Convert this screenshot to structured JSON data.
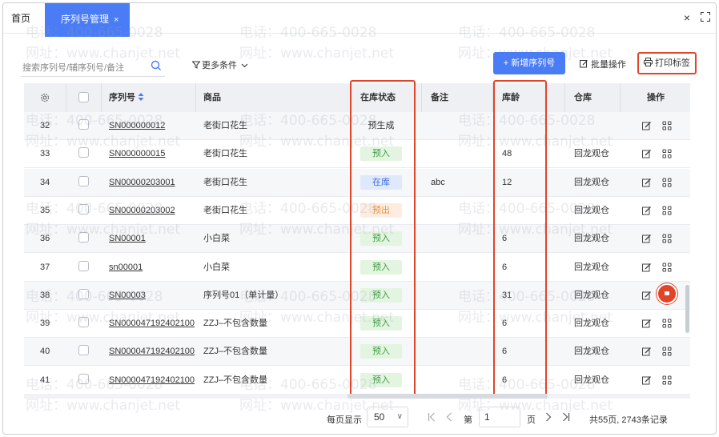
{
  "tabs": {
    "home": "首页",
    "active": "序列号管理",
    "close": "×"
  },
  "window": {
    "close": "×"
  },
  "toolbar": {
    "search_placeholder": "搜索序列号/辅序列号/备注",
    "more_filter": "更多条件",
    "new_button": "+ 新增序列号",
    "batch_button": "批量操作",
    "print_button": "打印标签"
  },
  "table": {
    "headers": {
      "serial": "序列号",
      "product": "商品",
      "status": "在库状态",
      "note": "备注",
      "age": "库龄",
      "warehouse": "仓库",
      "ops": "操作"
    },
    "rows": [
      {
        "no": "32",
        "serial": "SN000000012",
        "product": "老街口花生",
        "status": "预生成",
        "status_type": "pre",
        "note": "",
        "age": "",
        "warehouse": ""
      },
      {
        "no": "33",
        "serial": "SN000000015",
        "product": "老街口花生",
        "status": "预入",
        "status_type": "in",
        "note": "",
        "age": "48",
        "warehouse": "回龙观仓"
      },
      {
        "no": "34",
        "serial": "SN00000203001",
        "product": "老街口花生",
        "status": "在库",
        "status_type": "stock",
        "note": "abc",
        "age": "12",
        "warehouse": "回龙观仓"
      },
      {
        "no": "35",
        "serial": "SN00000203002",
        "product": "老街口花生",
        "status": "预出",
        "status_type": "out",
        "note": "",
        "age": "",
        "warehouse": "回龙观仓"
      },
      {
        "no": "36",
        "serial": "SN00001",
        "product": "小白菜",
        "status": "预入",
        "status_type": "in",
        "note": "",
        "age": "6",
        "warehouse": "回龙观仓"
      },
      {
        "no": "37",
        "serial": "sn00001",
        "product": "小白菜",
        "status": "预入",
        "status_type": "in",
        "note": "",
        "age": "6",
        "warehouse": "回龙观仓"
      },
      {
        "no": "38",
        "serial": "SN00003",
        "product": "序列号01（单计量）",
        "status": "预入",
        "status_type": "in",
        "note": "",
        "age": "31",
        "warehouse": "回龙观仓"
      },
      {
        "no": "39",
        "serial": "SN000047192402100",
        "product": "ZZJ–不包含数量",
        "status": "预入",
        "status_type": "in",
        "note": "",
        "age": "6",
        "warehouse": "回龙观仓"
      },
      {
        "no": "40",
        "serial": "SN000047192402100",
        "product": "ZZJ–不包含数量",
        "status": "预入",
        "status_type": "in",
        "note": "",
        "age": "6",
        "warehouse": "回龙观仓"
      },
      {
        "no": "41",
        "serial": "SN000047192402100",
        "product": "ZZJ–不包含数量",
        "status": "预入",
        "status_type": "in",
        "note": "",
        "age": "6",
        "warehouse": "回龙观仓"
      }
    ]
  },
  "pagination": {
    "per_page_label": "每页显示",
    "per_page": "50",
    "page_label": "第",
    "page": "1",
    "page_unit": "页",
    "total": "共55页, 2743条记录"
  },
  "watermark": {
    "phone": "电话：400-665-0028",
    "site": "网址：www.chanjet.net"
  },
  "colors": {
    "accent": "#4a7cf6",
    "highlight": "#e0452a"
  }
}
